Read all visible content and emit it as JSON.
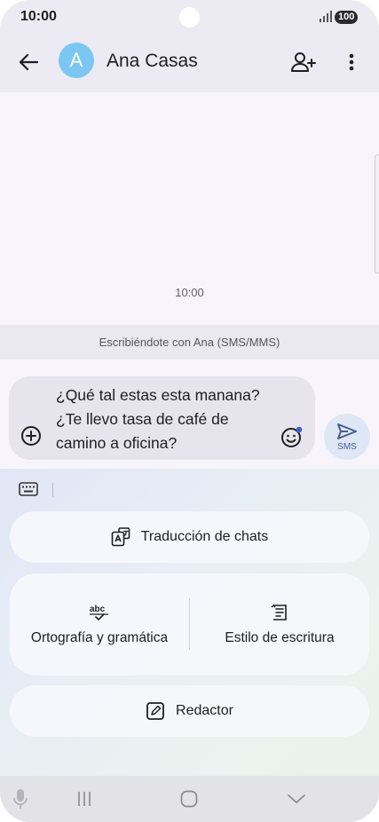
{
  "status_bar": {
    "time": "10:00",
    "battery": "100"
  },
  "header": {
    "contact_name": "Ana Casas",
    "avatar_letter": "A",
    "avatar_color": "#7cc7f2"
  },
  "conversation": {
    "message_time": "10:00",
    "mode_banner": "Escribiéndote con Ana (SMS/MMS)"
  },
  "compose": {
    "draft_text": "¿Qué tal estas esta manana?\n¿Te llevo tasa de café de\ncamino a oficina?",
    "send_label": "SMS"
  },
  "ai_panel": {
    "translate_label": "Traducción de chats",
    "spelling_label": "Ortografía y gramática",
    "style_label": "Estilo de escritura",
    "composer_label": "Redactor"
  },
  "icons": {
    "back": "arrow-left-icon",
    "add_contact": "person-add-icon",
    "more": "more-vert-icon",
    "attach": "add-circle-icon",
    "emoji": "emoji-icon",
    "send": "send-icon",
    "keyboard": "keyboard-icon",
    "translate": "translate-icon",
    "spelling": "spellcheck-icon",
    "style": "writing-style-icon",
    "composer": "edit-icon",
    "mic": "mic-icon"
  },
  "colors": {
    "accent": "#4a5d8f",
    "header_bg": "#eceaf2",
    "send_bg": "#dfe6f5"
  }
}
